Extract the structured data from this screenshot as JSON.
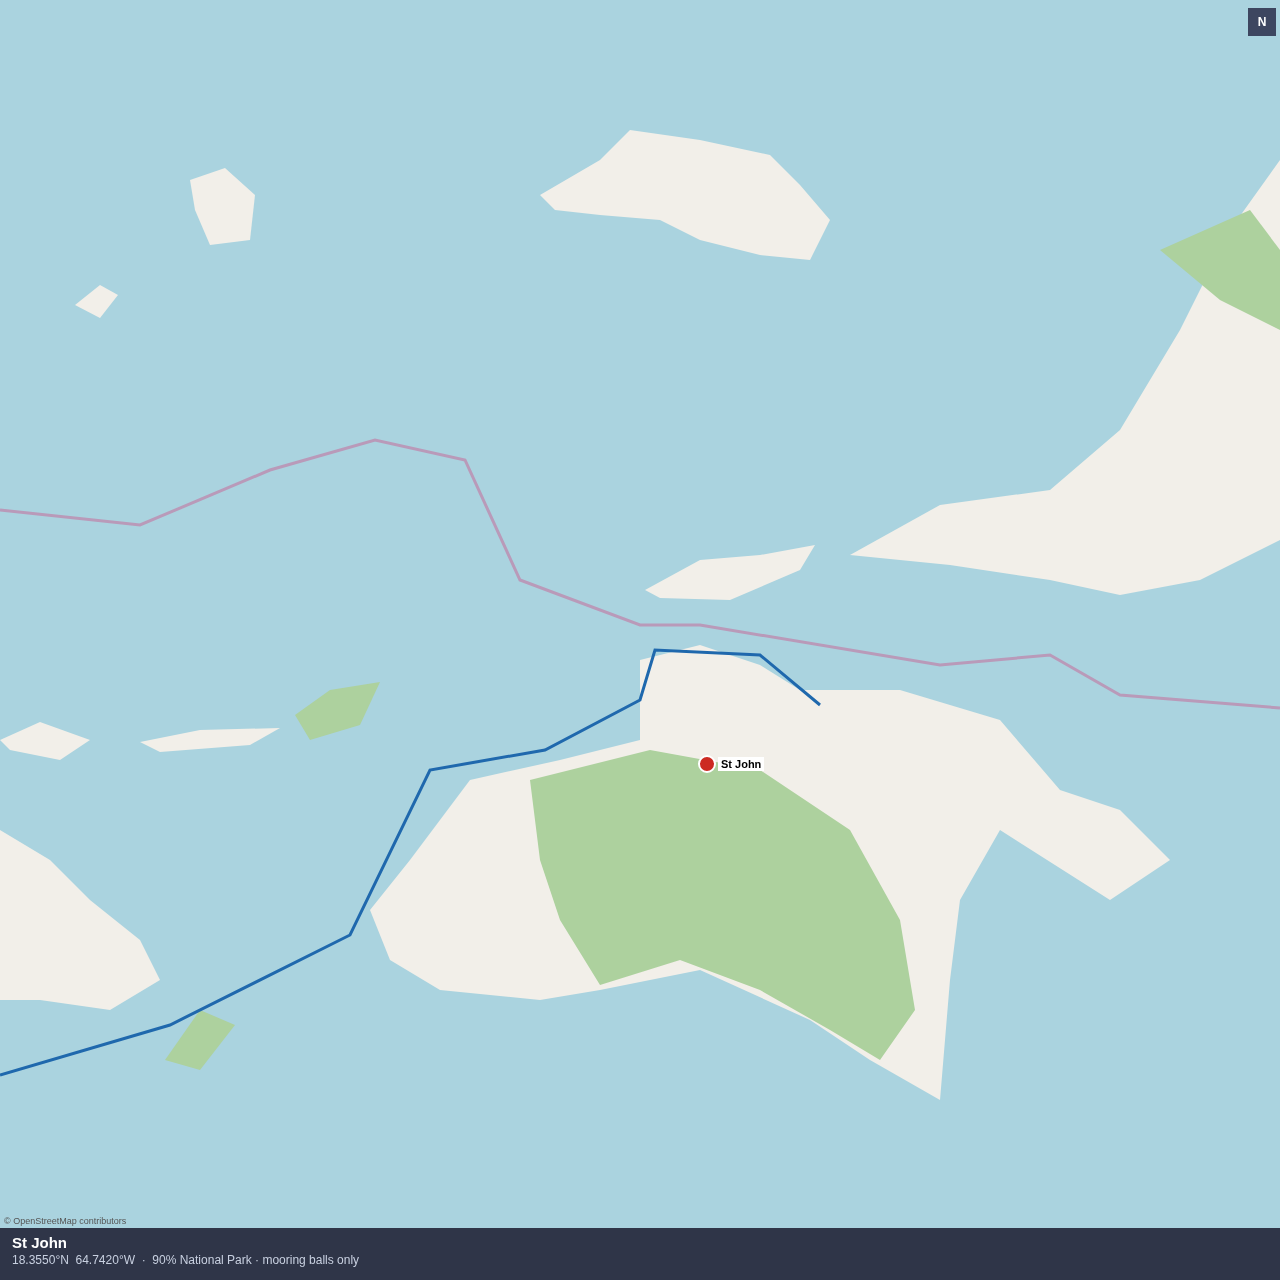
{
  "compass": {
    "label": "N"
  },
  "marker": {
    "label": "St John"
  },
  "attribution": "© OpenStreetMap contributors",
  "info_bar": {
    "title": "St John",
    "subtitle": "18.3550°N  64.7420°W  ·  90% National Park · mooring balls only"
  }
}
